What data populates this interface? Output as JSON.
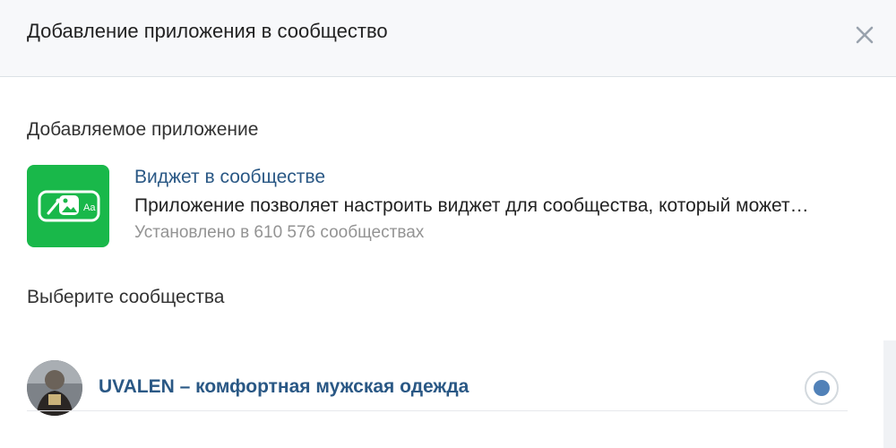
{
  "header": {
    "title": "Добавление приложения в сообщество",
    "close_icon": "close-icon"
  },
  "app_section": {
    "title": "Добавляемое приложение",
    "app": {
      "name": "Виджет в сообществе",
      "description": "Приложение позволяет настроить виджет для сообщества, который может…",
      "installs": "Установлено в 610 576 сообществах",
      "icon": "widget-app-icon",
      "icon_text": "Aa",
      "icon_color": "#19b84a"
    }
  },
  "community_section": {
    "title": "Выберите сообщества",
    "communities": [
      {
        "name": "UVALEN – комфортная мужская одежда",
        "avatar": "community-avatar",
        "selected": true
      }
    ]
  },
  "colors": {
    "link": "#2a5885",
    "accent": "#5181b8",
    "header_bg": "#f7f8fa",
    "muted_text": "#939393"
  }
}
